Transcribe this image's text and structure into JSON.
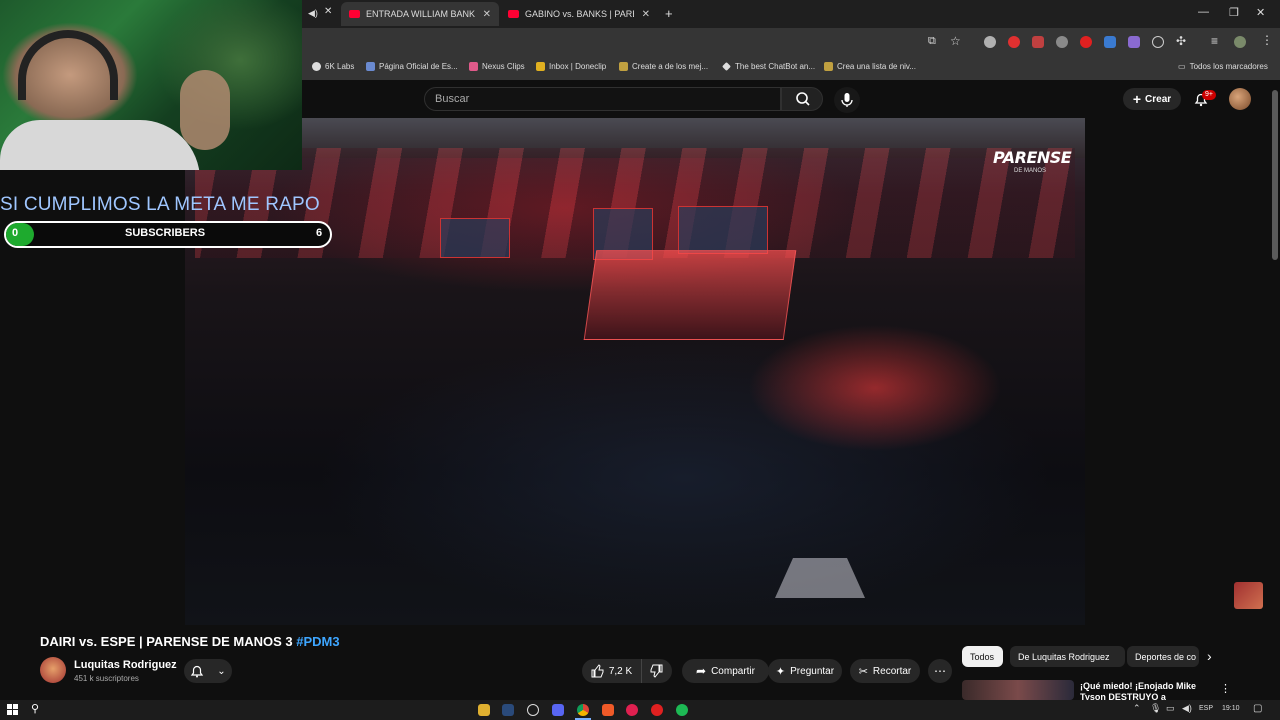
{
  "browser": {
    "tabs": [
      {
        "label": "ENTRADA WILLIAM BANKS | PA"
      },
      {
        "label": "GABINO vs. BANKS | PARENSE D"
      }
    ],
    "bookmarks": [
      {
        "label": "6K Labs"
      },
      {
        "label": "Página Oficial de Es..."
      },
      {
        "label": "Nexus Clips"
      },
      {
        "label": "Inbox | Doneclip"
      },
      {
        "label": "Create a de los mej..."
      },
      {
        "label": "The best ChatBot an..."
      },
      {
        "label": "Crea una lista de niv..."
      }
    ],
    "all_bookmarks": "Todos los marcadores"
  },
  "youtube": {
    "search": {
      "placeholder": "Buscar"
    },
    "create_label": "Crear",
    "notifications_badge": "9+"
  },
  "video": {
    "logo_text": "PARENSE",
    "logo_sub": "DE MANOS"
  },
  "stream_overlay": {
    "goal_text": "SI CUMPLIMOS LA META ME RAPO",
    "goal_start": "0",
    "goal_label": "SUBSCRIBERS",
    "goal_end": "6",
    "goal_progress": 0
  },
  "watch": {
    "title": "DAIRI vs. ESPE | PARENSE DE MANOS 3",
    "hashtag": "#PDM3",
    "channel_name": "Luquitas Rodriguez",
    "subscribers": "451 k suscriptores",
    "likes": "7,2 K",
    "share_label": "Compartir",
    "ask_label": "Preguntar",
    "clip_label": "Recortar"
  },
  "sidebar": {
    "chips": [
      {
        "label": "Todos"
      },
      {
        "label": "De Luquitas Rodriguez"
      },
      {
        "label": "Deportes de co"
      }
    ],
    "recommendation": {
      "title": "¡Qué miedo! ¡Enojado Mike Tyson DESTRUYO a peleadore"
    }
  },
  "taskbar": {
    "language": "ESP",
    "clock": "19:10"
  },
  "colors": {
    "youtube_red": "#ff0033",
    "goal_green": "#1eaa2e",
    "hashtag_blue": "#3ea6ff",
    "goal_text_blue": "#9fc6ff"
  }
}
